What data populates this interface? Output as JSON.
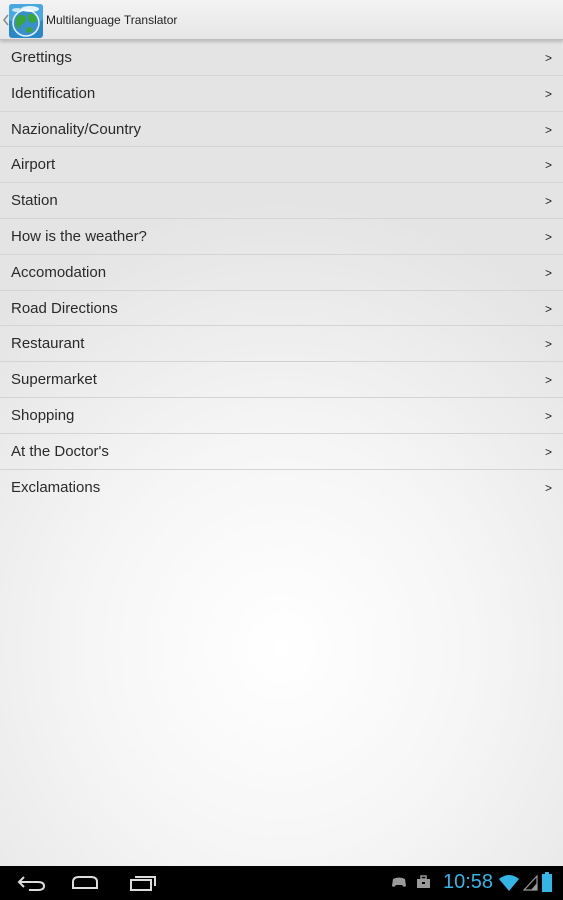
{
  "app": {
    "title": "Multilanguage Translator"
  },
  "menu": {
    "items": [
      {
        "label": "Grettings",
        "arrow": ">"
      },
      {
        "label": "Identification",
        "arrow": ">"
      },
      {
        "label": "Nazionality/Country",
        "arrow": ">"
      },
      {
        "label": "Airport",
        "arrow": ">"
      },
      {
        "label": "Station",
        "arrow": ">"
      },
      {
        "label": "How is the weather?",
        "arrow": ">"
      },
      {
        "label": "Accomodation",
        "arrow": ">"
      },
      {
        "label": "Road Directions",
        "arrow": ">"
      },
      {
        "label": "Restaurant",
        "arrow": ">"
      },
      {
        "label": "Supermarket",
        "arrow": ">"
      },
      {
        "label": "Shopping",
        "arrow": ">"
      },
      {
        "label": "At the Doctor's",
        "arrow": ">"
      },
      {
        "label": "Exclamations",
        "arrow": ">"
      }
    ]
  },
  "system_bar": {
    "time": "10:58",
    "accent_color": "#33b5e5",
    "icons": [
      "back-icon",
      "home-icon",
      "recent-apps-icon",
      "game-controller-icon",
      "briefcase-icon",
      "wifi-icon",
      "signal-icon",
      "battery-icon"
    ]
  }
}
